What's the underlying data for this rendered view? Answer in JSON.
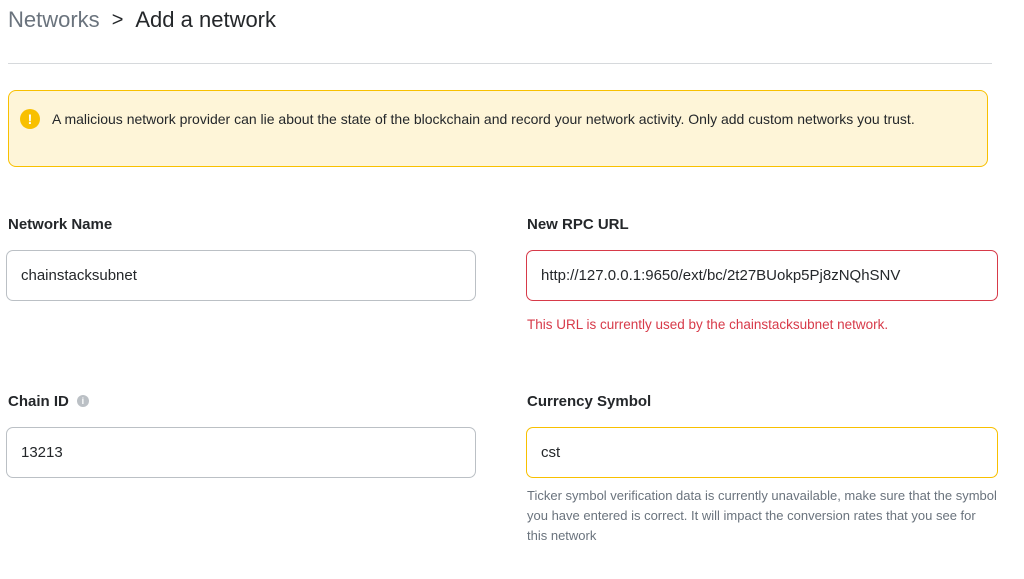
{
  "breadcrumb": {
    "root": "Networks",
    "separator": ">",
    "current": "Add a network"
  },
  "warning_banner": {
    "text": "A malicious network provider can lie about the state of the blockchain and record your network activity. Only add custom networks you trust."
  },
  "form": {
    "network_name": {
      "label": "Network Name",
      "value": "chainstacksubnet"
    },
    "rpc_url": {
      "label": "New RPC URL",
      "value": "http://127.0.0.1:9650/ext/bc/2t27BUokp5Pj8zNQhSNV",
      "error": "This URL is currently used by the chainstacksubnet network."
    },
    "chain_id": {
      "label": "Chain ID",
      "value": "13213"
    },
    "currency_symbol": {
      "label": "Currency Symbol",
      "value": "cst",
      "help": "Ticker symbol verification data is currently unavailable, make sure that the symbol you have entered is correct. It will impact the conversion rates that you see for this network"
    }
  },
  "colors": {
    "warning_bg": "#fef5d8",
    "warning_border": "#f8c000",
    "error": "#d73a49",
    "muted": "#6a737d"
  },
  "icons": {
    "warning": "exclamation-circle-icon",
    "info": "info-circle-icon",
    "breadcrumb_separator": "chevron-right-icon"
  }
}
